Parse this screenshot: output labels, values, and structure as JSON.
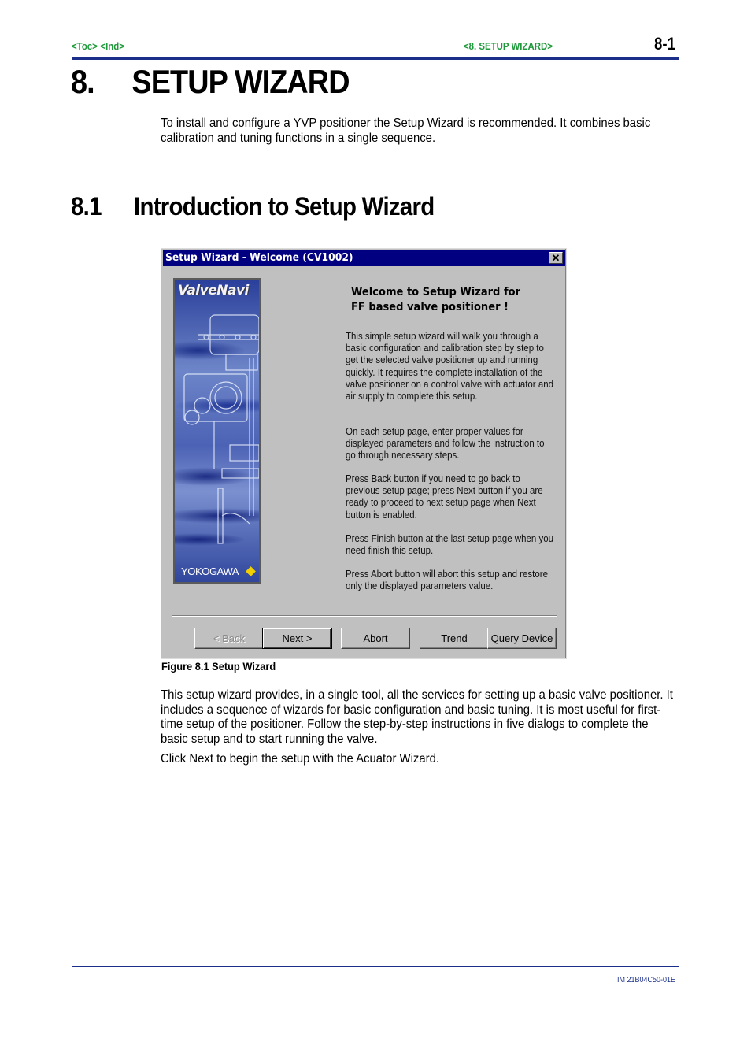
{
  "header": {
    "links": [
      "<Toc>",
      "<Ind>"
    ],
    "section_link": "<8.  SETUP WIZARD>",
    "page_number": "8-1"
  },
  "chapter": {
    "number": "8.",
    "title": "SETUP WIZARD"
  },
  "intro_paragraph": "To install and configure a YVP positioner the Setup Wizard is recommended.  It combines basic calibration and tuning functions in a single sequence.",
  "section": {
    "number": "8.1",
    "title": "Introduction to Setup Wizard"
  },
  "dialog": {
    "title": "Setup Wizard - Welcome (CV1002)",
    "close_glyph": "✕",
    "banner": {
      "brand": "ValveNavi",
      "logo_text": "YOKOGAWA"
    },
    "welcome_heading": "Welcome to Setup Wizard for FF based valve positioner !",
    "paragraphs": [
      "This simple setup wizard will walk you through a basic configuration and calibration step by step to get the selected valve positioner up and running quickly. It requires the complete installation of the valve positioner on a control valve with actuator and air supply to complete this setup.",
      "On each setup page, enter proper values for displayed parameters and follow the instruction to go through necessary steps.",
      "Press Back button if you need to go back to previous setup page; press Next button if you are ready to proceed to next setup page when Next button is enabled.",
      "Press Finish button at the last setup page when you need finish this setup.",
      "Press Abort button will abort this setup and restore only the displayed parameters value."
    ],
    "buttons": {
      "back": {
        "label": "< Back",
        "enabled": false
      },
      "next": {
        "label": "Next >",
        "enabled": true,
        "default": true
      },
      "abort": {
        "label": "Abort",
        "enabled": true
      },
      "trend": {
        "label": "Trend",
        "enabled": true
      },
      "query": {
        "label": "Query Device",
        "enabled": true
      }
    }
  },
  "figure_caption": "Figure 8.1 Setup Wizard",
  "body_paragraphs": [
    "This setup wizard provides, in a single tool, all the services for setting up a basic valve positioner.  It includes a sequence of wizards for basic configuration and basic tuning.   It is most useful for first-time setup of the positioner.  Follow the step-by-step instructions in five dialogs to complete the basic setup and to start running the valve.",
    "Click Next to begin the setup with the Acuator Wizard."
  ],
  "footer": {
    "doc_id": "IM 21B04C50-01E"
  },
  "colors": {
    "link_green": "#1f9a3b",
    "rule_blue": "#1b2f8a",
    "titlebar_navy": "#000080",
    "dialog_gray": "#c0c0c0"
  }
}
